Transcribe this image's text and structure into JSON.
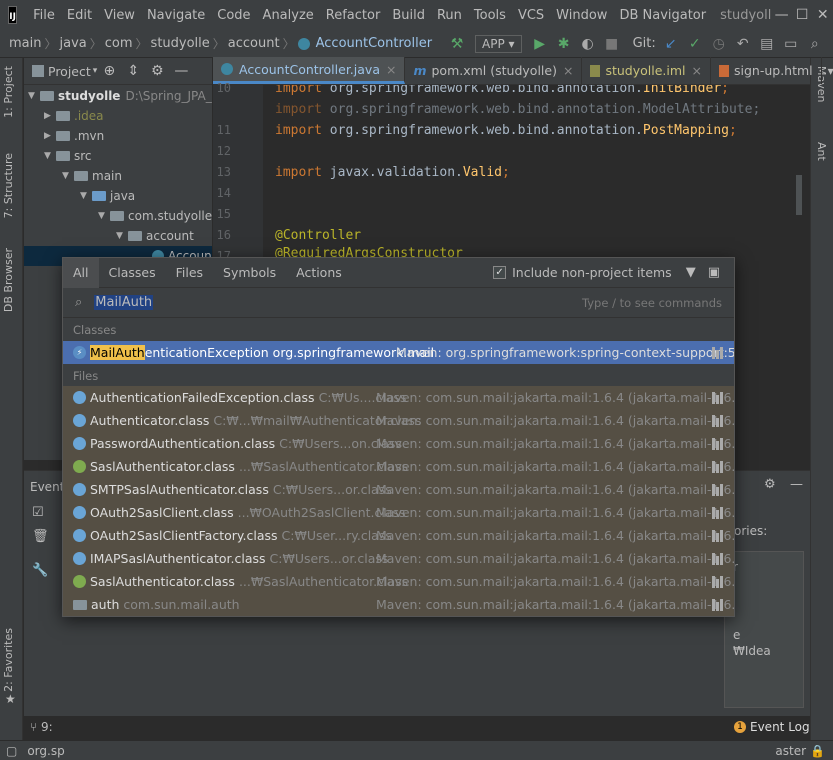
{
  "menubar": {
    "items": [
      "File",
      "Edit",
      "View",
      "Navigate",
      "Code",
      "Analyze",
      "Refactor",
      "Build",
      "Run",
      "Tools",
      "VCS",
      "Window",
      "DB Navigator"
    ],
    "project_name": "studyoll",
    "logo": "IJ"
  },
  "navbar": {
    "crumbs": [
      "main",
      "java",
      "com",
      "studyolle",
      "account",
      "AccountController"
    ],
    "run_config": "APP",
    "git_label": "Git:"
  },
  "left_stripe": {
    "project": "1: Project",
    "structure": "7: Structure",
    "db_browser": "DB Browser",
    "favorites": "2: Favorites"
  },
  "right_stripe": {
    "maven": "Maven",
    "ant": "Ant"
  },
  "project_pane": {
    "title": "Project",
    "root_name": "studyolle",
    "root_path": "D:\\Spring_JPA_...",
    "items": [
      ".idea",
      ".mvn",
      "src",
      "main",
      "java",
      "com.studyolle",
      "account",
      "Accoun"
    ]
  },
  "editor": {
    "tabs": [
      "AccountController.java",
      "pom.xml (studyolle)",
      "studyolle.iml",
      "sign-up.html"
    ],
    "lines": [
      {
        "n": "10",
        "kw": "import",
        "pkg": "org.springframework.web.bind.annotation.",
        "cls": "InitBinder",
        "end": ";"
      },
      {
        "n": "11",
        "kw": "import",
        "pkg": "org.springframework.web.bind.annotation.",
        "cls": "ModelAttribute",
        "end": ";"
      },
      {
        "n": "12",
        "kw": "import",
        "pkg": "org.springframework.web.bind.annotation.",
        "cls": "PostMapping",
        "end": ";"
      },
      {
        "n": "13"
      },
      {
        "n": "14",
        "kw": "import",
        "pkg": "javax.validation.",
        "cls": "Valid",
        "end": ";"
      },
      {
        "n": "15"
      },
      {
        "n": "16"
      },
      {
        "n": "17",
        "ann": "@Controller"
      },
      {
        "n": "18",
        "ann": "@RequiredArgsConstructor"
      }
    ]
  },
  "bottom": {
    "event_label": "Event",
    "side_text1": "ories:",
    "side_text2": "r",
    "side_text3": "e",
    "side_text4": "₩Idea",
    "event_log": "Event Log",
    "event_count": "1"
  },
  "status": {
    "left": "org.sp",
    "tab9": "9:",
    "branch": "aster"
  },
  "popup": {
    "tabs": [
      "All",
      "Classes",
      "Files",
      "Symbols",
      "Actions"
    ],
    "include_label": "Include non-project items",
    "search_value": "MailAuth",
    "search_hint": "Type / to see commands",
    "classes_label": "Classes",
    "files_label": "Files",
    "selected": {
      "match": "MailAuth",
      "rest": "enticationException",
      "package": "org.springframework.mail",
      "location": "Maven: org.springframework:spring-context-support:5.2..."
    },
    "files": [
      {
        "name": "AuthenticationFailedException.class",
        "path": "C:₩Us....class",
        "loc": "Maven: com.sun.mail:jakarta.mail:1.6.4 (jakarta.mail-1.6.4.jar)",
        "icon": "cls"
      },
      {
        "name": "Authenticator.class",
        "path": "C:₩...₩mail₩Authenticator.class",
        "loc": "Maven: com.sun.mail:jakarta.mail:1.6.4 (jakarta.mail-1.6.4.jar)",
        "icon": "cls"
      },
      {
        "name": "PasswordAuthentication.class",
        "path": "C:₩Users...on.class",
        "loc": "Maven: com.sun.mail:jakarta.mail:1.6.4 (jakarta.mail-1.6.4.jar)",
        "icon": "cls"
      },
      {
        "name": "SaslAuthenticator.class",
        "path": "...₩SaslAuthenticator.class",
        "loc": "Maven: com.sun.mail:jakarta.mail:1.6.4 (jakarta.mail-1.6.4.jar)",
        "icon": "iface"
      },
      {
        "name": "SMTPSaslAuthenticator.class",
        "path": "C:₩Users...or.class",
        "loc": "Maven: com.sun.mail:jakarta.mail:1.6.4 (jakarta.mail-1.6.4.jar)",
        "icon": "cls"
      },
      {
        "name": "OAuth2SaslClient.class",
        "path": "...₩OAuth2SaslClient.class",
        "loc": "Maven: com.sun.mail:jakarta.mail:1.6.4 (jakarta.mail-1.6.4.jar)",
        "icon": "cls"
      },
      {
        "name": "OAuth2SaslClientFactory.class",
        "path": "C:₩User...ry.class",
        "loc": "Maven: com.sun.mail:jakarta.mail:1.6.4 (jakarta.mail-1.6.4.jar)",
        "icon": "cls"
      },
      {
        "name": "IMAPSaslAuthenticator.class",
        "path": "C:₩Users...or.class",
        "loc": "Maven: com.sun.mail:jakarta.mail:1.6.4 (jakarta.mail-1.6.4.jar)",
        "icon": "cls"
      },
      {
        "name": "SaslAuthenticator.class",
        "path": "...₩SaslAuthenticator.class",
        "loc": "Maven: com.sun.mail:jakarta.mail:1.6.4 (jakarta.mail-1.6.4.jar)",
        "icon": "iface"
      },
      {
        "name": "auth",
        "path": "com.sun.mail.auth",
        "loc": "Maven: com.sun.mail:jakarta.mail:1.6.4 (jakarta.mail-1.6.4.jar)",
        "icon": "pkg"
      }
    ]
  }
}
